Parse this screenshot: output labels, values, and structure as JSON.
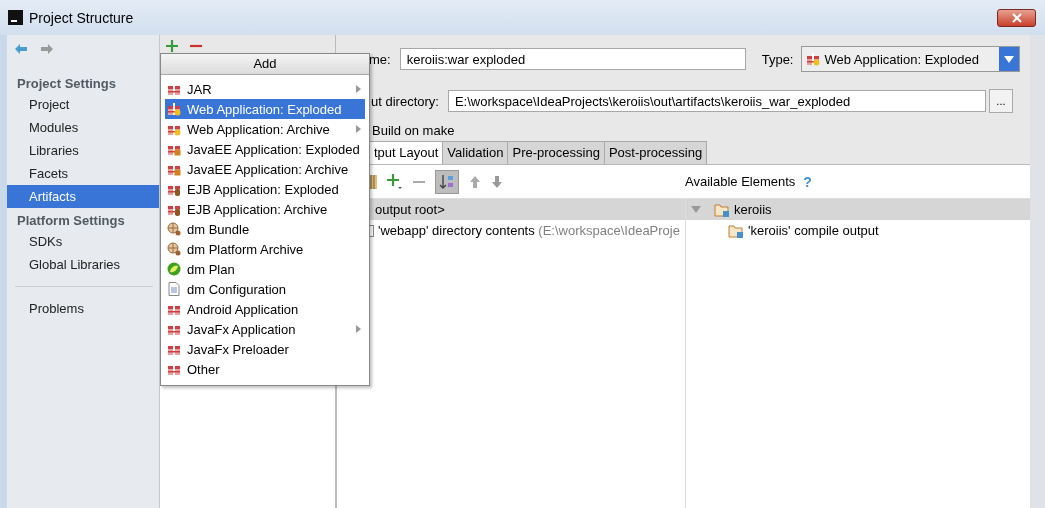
{
  "window": {
    "title": "Project Structure"
  },
  "sidebar": {
    "sections": [
      {
        "title": "Project Settings",
        "items": [
          {
            "label": "Project",
            "selected": false
          },
          {
            "label": "Modules",
            "selected": false
          },
          {
            "label": "Libraries",
            "selected": false
          },
          {
            "label": "Facets",
            "selected": false
          },
          {
            "label": "Artifacts",
            "selected": true
          }
        ]
      },
      {
        "title": "Platform Settings",
        "items": [
          {
            "label": "SDKs",
            "selected": false
          },
          {
            "label": "Global Libraries",
            "selected": false
          }
        ]
      },
      {
        "items": [
          {
            "label": "Problems",
            "selected": false
          }
        ]
      }
    ]
  },
  "add_menu": {
    "title": "Add",
    "items": [
      {
        "label": "JAR",
        "kind": "gift",
        "selected": false,
        "submenu": true
      },
      {
        "label": "Web Application: Exploded",
        "kind": "web",
        "selected": true,
        "submenu": false
      },
      {
        "label": "Web Application: Archive",
        "kind": "web",
        "selected": false,
        "submenu": true
      },
      {
        "label": "JavaEE Application: Exploded",
        "kind": "ee",
        "selected": false,
        "submenu": false
      },
      {
        "label": "JavaEE Application: Archive",
        "kind": "ee",
        "selected": false,
        "submenu": false
      },
      {
        "label": "EJB Application: Exploded",
        "kind": "ejb",
        "selected": false,
        "submenu": false
      },
      {
        "label": "EJB Application: Archive",
        "kind": "ejb",
        "selected": false,
        "submenu": false
      },
      {
        "label": "dm Bundle",
        "kind": "globe",
        "selected": false,
        "submenu": false
      },
      {
        "label": "dm Platform Archive",
        "kind": "globe",
        "selected": false,
        "submenu": false
      },
      {
        "label": "dm Plan",
        "kind": "plan",
        "selected": false,
        "submenu": false
      },
      {
        "label": "dm Configuration",
        "kind": "doc",
        "selected": false,
        "submenu": false
      },
      {
        "label": "Android Application",
        "kind": "gift",
        "selected": false,
        "submenu": false
      },
      {
        "label": "JavaFx Application",
        "kind": "gift",
        "selected": false,
        "submenu": true
      },
      {
        "label": "JavaFx Preloader",
        "kind": "gift",
        "selected": false,
        "submenu": false
      },
      {
        "label": "Other",
        "kind": "gift",
        "selected": false,
        "submenu": false
      }
    ]
  },
  "artifact": {
    "name_label": "me:",
    "name": "keroiis:war exploded",
    "type_label": "Type:",
    "type": "Web Application: Exploded",
    "output_label": "ut directory:",
    "output_directory": "E:\\workspace\\IdeaProjects\\keroiis\\out\\artifacts\\keroiis_war_exploded",
    "browse": "...",
    "build_on_make": "Build on make"
  },
  "tabs": [
    {
      "label": "tput Layout",
      "selected": true
    },
    {
      "label": "Validation",
      "selected": false
    },
    {
      "label": "Pre-processing",
      "selected": false
    },
    {
      "label": "Post-processing",
      "selected": false
    }
  ],
  "layout_tree": {
    "rows": [
      {
        "label": "output root>",
        "selected": true
      },
      {
        "label": "'webapp' directory contents",
        "detail": "(E:\\workspace\\IdeaProje",
        "selected": false
      }
    ]
  },
  "available": {
    "title": "Available Elements",
    "help": "?",
    "tree": [
      {
        "label": "keroiis",
        "expanded": true,
        "selected": true,
        "children": [
          {
            "label": "'keroiis' compile output",
            "selected": false
          }
        ]
      }
    ]
  }
}
